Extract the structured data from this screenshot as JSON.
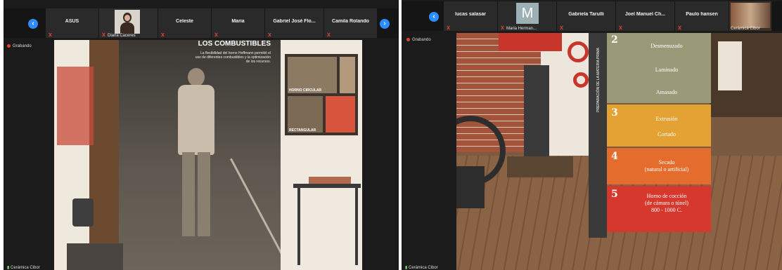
{
  "left": {
    "participants": [
      "ASUS",
      "Diana Caceres",
      "Celeste",
      "Maria",
      "Gabriel José Flo...",
      "Camila Rolando"
    ],
    "recording": "Grabando",
    "footer": "Cerámica Cibor",
    "poster_title": "LOS COMBUSTIBLES",
    "poster_text": "La flexibilidad del horno Hoffmann permitió el uso de diferentes combustibles y la optimización de los recursos.",
    "board_labels": [
      "HORNO CIRCULAR",
      "RECTANGULAR"
    ]
  },
  "right": {
    "participants": [
      "lucas salasar",
      "Maria Herman...",
      "Gabriela Tarulli",
      "Joel Manuel Ch...",
      "Paulo hansen",
      "Cerámica Cibor"
    ],
    "avatar_letter": "M",
    "recording": "Grabando",
    "footer": "Cerámica Cibor",
    "banner_side": "PREPARACIÓN DE LA MATERIA PRIMA",
    "steps": [
      {
        "num": "2",
        "lines": [
          "Desmenuzado",
          "Laminado",
          "Amasado"
        ],
        "color": "#9a9a78"
      },
      {
        "num": "3",
        "lines": [
          "Extrusión",
          "Cortado"
        ],
        "color": "#e5a234"
      },
      {
        "num": "4",
        "lines": [
          "Secado",
          "(natural o artificial)"
        ],
        "color": "#e46c2c"
      },
      {
        "num": "5",
        "lines": [
          "Horno de cocción",
          "(de cámara o túnel)",
          "800 - 1000 C."
        ],
        "color": "#d6382d"
      }
    ]
  }
}
